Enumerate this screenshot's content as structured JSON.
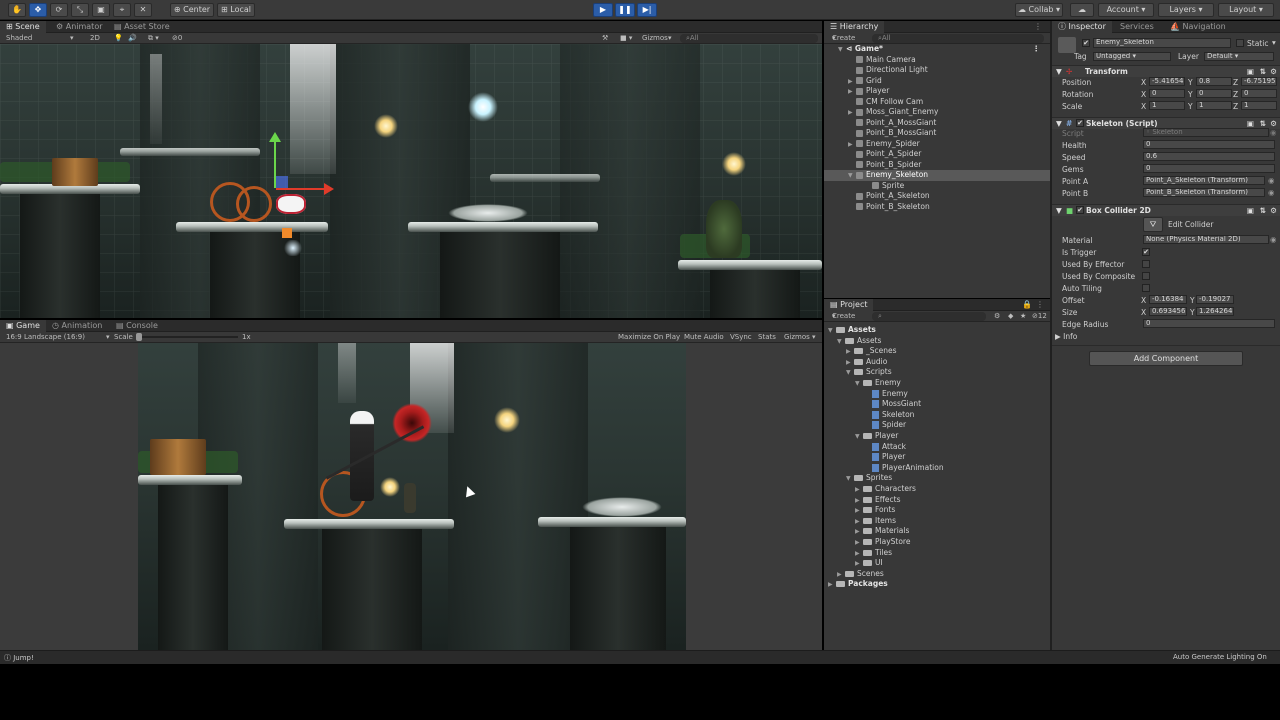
{
  "toolbar": {
    "tools": [
      "hand-tool",
      "move-tool",
      "rotate-tool",
      "scale-tool",
      "rect-tool",
      "transform-tool",
      "custom-tool"
    ],
    "center_label": "Center",
    "local_label": "Local",
    "collab_label": "Collab",
    "account_label": "Account",
    "layers_label": "Layers",
    "layout_label": "Layout"
  },
  "scene": {
    "tabs": [
      "Scene",
      "Animator",
      "Asset Store"
    ],
    "shading": "Shaded",
    "mode_2d": "2D",
    "gizmos_label": "Gizmos",
    "search_placeholder": "All",
    "gizmo_count": "0"
  },
  "game": {
    "tabs": [
      "Game",
      "Animation",
      "Console"
    ],
    "aspect": "16:9 Landscape (16:9)",
    "scale_label": "Scale",
    "scale_value": "1x",
    "toggles": [
      "Maximize On Play",
      "Mute Audio",
      "VSync",
      "Stats",
      "Gizmos"
    ]
  },
  "hierarchy": {
    "tab": "Hierarchy",
    "create_label": "Create",
    "search_placeholder": "All",
    "root": "Game*",
    "items": [
      {
        "label": "Main Camera",
        "arrow": "",
        "selected": false
      },
      {
        "label": "Directional Light",
        "arrow": "",
        "selected": false
      },
      {
        "label": "Grid",
        "arrow": "▶",
        "selected": false
      },
      {
        "label": "Player",
        "arrow": "▶",
        "selected": false
      },
      {
        "label": "CM Follow Cam",
        "arrow": "",
        "selected": false
      },
      {
        "label": "Moss_Giant_Enemy",
        "arrow": "▶",
        "selected": false
      },
      {
        "label": "Point_A_MossGiant",
        "arrow": "",
        "selected": false
      },
      {
        "label": "Point_B_MossGiant",
        "arrow": "",
        "selected": false
      },
      {
        "label": "Enemy_Spider",
        "arrow": "▶",
        "selected": false
      },
      {
        "label": "Point_A_Spider",
        "arrow": "",
        "selected": false
      },
      {
        "label": "Point_B_Spider",
        "arrow": "",
        "selected": false
      },
      {
        "label": "Enemy_Skeleton",
        "arrow": "▼",
        "selected": true
      },
      {
        "label": "Sprite",
        "arrow": "",
        "selected": false,
        "child": true
      },
      {
        "label": "Point_A_Skeleton",
        "arrow": "",
        "selected": false
      },
      {
        "label": "Point_B_Skeleton",
        "arrow": "",
        "selected": false
      }
    ]
  },
  "project": {
    "tab": "Project",
    "create_label": "Create",
    "count": "12",
    "tree": [
      {
        "label": "Assets",
        "depth": 0,
        "arrow": "▼",
        "bold": true
      },
      {
        "label": "Assets",
        "depth": 1,
        "arrow": "▼"
      },
      {
        "label": "_Scenes",
        "depth": 2,
        "arrow": "▶"
      },
      {
        "label": "Audio",
        "depth": 2,
        "arrow": "▶"
      },
      {
        "label": "Scripts",
        "depth": 2,
        "arrow": "▼"
      },
      {
        "label": "Enemy",
        "depth": 3,
        "arrow": "▼"
      },
      {
        "label": "Enemy",
        "depth": 4,
        "arrow": "",
        "file": true
      },
      {
        "label": "MossGiant",
        "depth": 4,
        "arrow": "",
        "file": true
      },
      {
        "label": "Skeleton",
        "depth": 4,
        "arrow": "",
        "file": true
      },
      {
        "label": "Spider",
        "depth": 4,
        "arrow": "",
        "file": true
      },
      {
        "label": "Player",
        "depth": 3,
        "arrow": "▼"
      },
      {
        "label": "Attack",
        "depth": 4,
        "arrow": "",
        "file": true
      },
      {
        "label": "Player",
        "depth": 4,
        "arrow": "",
        "file": true
      },
      {
        "label": "PlayerAnimation",
        "depth": 4,
        "arrow": "",
        "file": true
      },
      {
        "label": "Sprites",
        "depth": 2,
        "arrow": "▼"
      },
      {
        "label": "Characters",
        "depth": 3,
        "arrow": "▶"
      },
      {
        "label": "Effects",
        "depth": 3,
        "arrow": "▶"
      },
      {
        "label": "Fonts",
        "depth": 3,
        "arrow": "▶"
      },
      {
        "label": "Items",
        "depth": 3,
        "arrow": "▶"
      },
      {
        "label": "Materials",
        "depth": 3,
        "arrow": "▶"
      },
      {
        "label": "PlayStore",
        "depth": 3,
        "arrow": "▶"
      },
      {
        "label": "Tiles",
        "depth": 3,
        "arrow": "▶"
      },
      {
        "label": "UI",
        "depth": 3,
        "arrow": "▶"
      },
      {
        "label": "Scenes",
        "depth": 1,
        "arrow": "▶"
      },
      {
        "label": "Packages",
        "depth": 0,
        "arrow": "▶",
        "bold": true
      }
    ]
  },
  "inspector": {
    "tabs": [
      "Inspector",
      "Services",
      "Navigation"
    ],
    "object_name": "Enemy_Skeleton",
    "static_label": "Static",
    "tag_label": "Tag",
    "tag_value": "Untagged",
    "layer_label": "Layer",
    "layer_value": "Default",
    "transform": {
      "title": "Transform",
      "rows": [
        {
          "label": "Position",
          "x": "-5.41654",
          "y": "0.8",
          "z": "-6.75195"
        },
        {
          "label": "Rotation",
          "x": "0",
          "y": "0",
          "z": "0"
        },
        {
          "label": "Scale",
          "x": "1",
          "y": "1",
          "z": "1"
        }
      ]
    },
    "skeleton": {
      "title": "Skeleton (Script)",
      "script_label": "Script",
      "script_value": "Skeleton",
      "fields": [
        {
          "label": "Health",
          "value": "0"
        },
        {
          "label": "Speed",
          "value": "0.6"
        },
        {
          "label": "Gems",
          "value": "0"
        },
        {
          "label": "Point A",
          "value": "Point_A_Skeleton (Transform)"
        },
        {
          "label": "Point B",
          "value": "Point_B_Skeleton (Transform)"
        }
      ]
    },
    "collider": {
      "title": "Box Collider 2D",
      "edit_label": "Edit Collider",
      "material_label": "Material",
      "material_value": "None (Physics Material 2D)",
      "checks": [
        {
          "label": "Is Trigger",
          "checked": "✔"
        },
        {
          "label": "Used By Effector",
          "checked": ""
        },
        {
          "label": "Used By Composite",
          "checked": ""
        },
        {
          "label": "Auto Tiling",
          "checked": ""
        }
      ],
      "offset_label": "Offset",
      "offset_x": "-0.16384",
      "offset_y": "-0.19027",
      "size_label": "Size",
      "size_x": "0.693456",
      "size_y": "1.264264",
      "edge_label": "Edge Radius",
      "edge_value": "0",
      "info_label": "Info"
    },
    "add_component": "Add Component"
  },
  "status": {
    "left": "Jump!",
    "right": "Auto Generate Lighting On"
  }
}
